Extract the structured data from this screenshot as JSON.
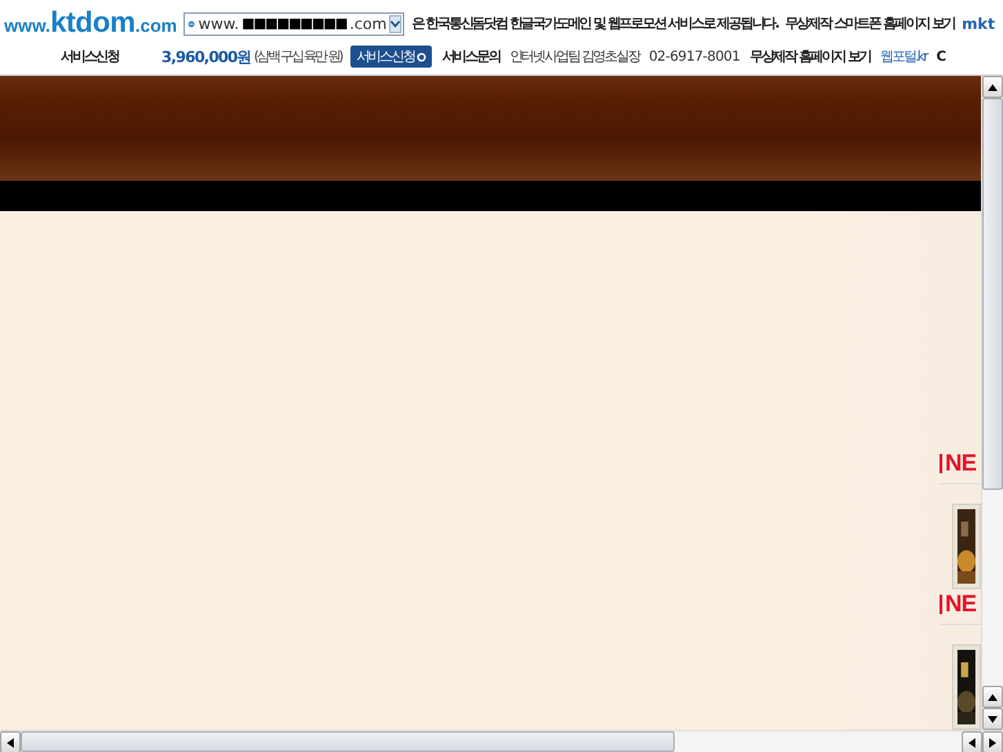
{
  "banner": {
    "logo": {
      "prefix": "www.",
      "name": "ktdom",
      "suffix": ".com"
    },
    "domain_field": {
      "prefix": "www.",
      "masked": "■■■■■■■■■",
      "suffix": ".com"
    },
    "notice": "은 한국통신돔닷컴 한글국가도메인 및 웹프로모션 서비스로 제공됩니다.",
    "top_link": "무상제작 스마트폰 홈페이지 보기",
    "top_cut": "mkt",
    "service_label": "서비스신청",
    "price": "3,960,000원",
    "price_words": "(삼백 구십 육만 원)",
    "apply_button": "서비스신청",
    "inquiry": "서비스문의",
    "contact": "인터넷사업팀 김영초실장",
    "phone": "02-6917-8001",
    "home_link": "무상제작 홈페이지 보기",
    "portal_link": "웹포털.kr",
    "cut_text": "C"
  },
  "page": {
    "sections": [
      {
        "heading": "NE"
      },
      {
        "heading": "NE"
      }
    ]
  }
}
